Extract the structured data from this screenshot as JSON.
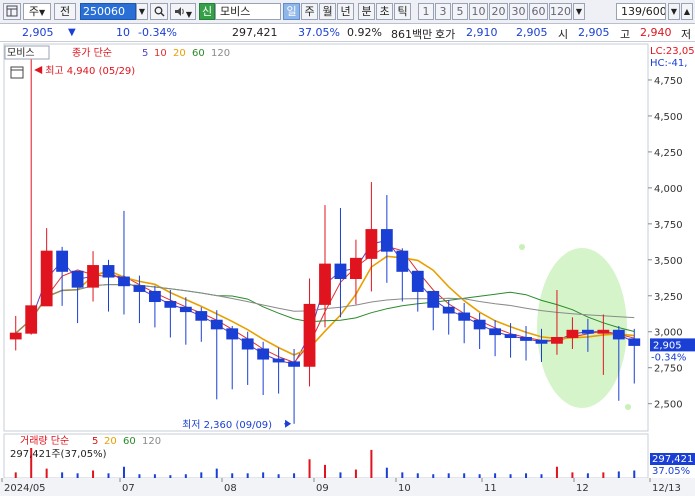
{
  "toolbar": {
    "menu_icon": "window-icon",
    "market": "주",
    "market_dd": "▼",
    "mode": "전",
    "code": "250060",
    "search_icon": "magnifier-icon",
    "add_icon": "plus-icon",
    "sound_icon": "speaker-icon",
    "sound_dd": "▼",
    "sin_badge": "신",
    "name": "모비스",
    "periods": [
      "일",
      "주",
      "월",
      "년"
    ],
    "periods2": [
      "분",
      "초",
      "틱"
    ],
    "intervals": [
      "1",
      "3",
      "5",
      "10",
      "20",
      "30",
      "60",
      "120"
    ],
    "interval_dd": "▼",
    "count": "139",
    "count_total": "/600",
    "colors": {
      "selected": "#8fb6e8",
      "code_bg": "#2a6fd6",
      "sin_bg": "#35a047"
    }
  },
  "pricebar": {
    "price": "2,905",
    "arrow": "▼",
    "change": "10",
    "change_pct": "-0.34%",
    "volume": "297,421",
    "vol_ratio": "37.05%",
    "turnover": "0.92%",
    "amount": "861백만",
    "bid_label": "호가",
    "bid1": "2,910",
    "bid2": "2,905",
    "open_label": "시",
    "open": "2,905",
    "high_label": "고",
    "high": "2,940",
    "low_label": "저"
  },
  "chart_data": {
    "type": "candlestick",
    "legend_name": "모비스",
    "legend_ma_label": "종가 단순",
    "ma_periods": [
      "5",
      "10",
      "20",
      "60",
      "120"
    ],
    "ma_colors": [
      "#5b3fc4",
      "#e03030",
      "#e8a000",
      "#2a8a2a",
      "#8a8a8a"
    ],
    "right_top": "LC:23,05",
    "right_top2": "HC:-41,",
    "max_label": "최고 4,940 (05/29)",
    "min_label": "최저 2,360 (09/09)",
    "current_label": "2,905",
    "current_pct": "-0.34%",
    "y_ticks": [
      "4,750",
      "4,500",
      "4,250",
      "4,000",
      "3,750",
      "3,500",
      "3,250",
      "3,000",
      "2,750",
      "2,500"
    ],
    "y_values": [
      4750,
      4500,
      4250,
      4000,
      3750,
      3500,
      3250,
      3000,
      2750,
      2500
    ],
    "x_labels": [
      "2024/05",
      "07",
      "08",
      "09",
      "10",
      "11",
      "12",
      "12/13"
    ],
    "close": [
      2990,
      3180,
      3560,
      3420,
      3310,
      3460,
      3380,
      3320,
      3280,
      3210,
      3170,
      3140,
      3080,
      3020,
      2950,
      2880,
      2810,
      2790,
      2760,
      3190,
      3470,
      3370,
      3510,
      3710,
      3560,
      3420,
      3280,
      3170,
      3130,
      3080,
      3020,
      2980,
      2960,
      2940,
      2920,
      2960,
      3010,
      2990,
      3010,
      2950,
      2905
    ],
    "high": [
      3110,
      4940,
      3720,
      3590,
      3420,
      3560,
      3500,
      3840,
      3390,
      3320,
      3290,
      3240,
      3170,
      3150,
      3040,
      3000,
      2930,
      2890,
      2880,
      3370,
      3880,
      3860,
      3640,
      4040,
      3950,
      3580,
      3410,
      3270,
      3220,
      3200,
      3130,
      3080,
      3060,
      3040,
      3020,
      3290,
      3100,
      3090,
      3120,
      3040,
      3020
    ],
    "low": [
      2870,
      2980,
      3270,
      3180,
      3060,
      3210,
      3140,
      3120,
      3060,
      3030,
      2960,
      2910,
      2930,
      2530,
      2600,
      2630,
      2560,
      2570,
      2360,
      2620,
      3030,
      3100,
      3190,
      3280,
      3340,
      3210,
      3140,
      3010,
      2980,
      2920,
      2880,
      2830,
      2820,
      2800,
      2790,
      2840,
      2880,
      2860,
      2700,
      2520,
      2640
    ],
    "volume": [
      6,
      32,
      10,
      6,
      5,
      8,
      5,
      12,
      4,
      4,
      3,
      4,
      6,
      10,
      5,
      5,
      6,
      4,
      5,
      20,
      14,
      6,
      9,
      30,
      11,
      6,
      5,
      4,
      5,
      5,
      4,
      5,
      4,
      5,
      4,
      12,
      6,
      5,
      6,
      7,
      8
    ],
    "volume_legend": "거래량 단순",
    "volume_ma": [
      "5",
      "20",
      "60",
      "120"
    ],
    "volume_value": "297,421주(37,05%)",
    "volume_right": "297,421",
    "volume_right_pct": "37.05%"
  }
}
